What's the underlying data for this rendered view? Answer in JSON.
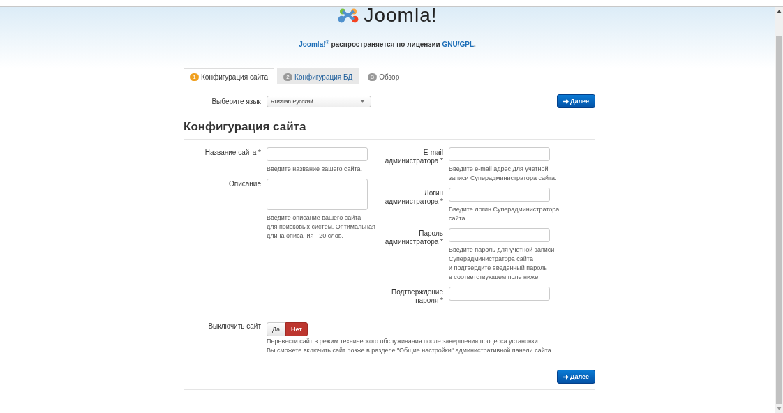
{
  "header": {
    "logo_text": "Joomla!",
    "license": {
      "brand": "Joomla!$^{®}$",
      "text": "распространяется по лицензии",
      "link": "GNU/GPL",
      "end": "."
    }
  },
  "tabs": [
    {
      "number": "1",
      "label": "Конфигурация сайта",
      "selected": true,
      "enabled": true
    },
    {
      "number": "2",
      "label": "Конфигурация БД",
      "selected": false,
      "enabled": true
    },
    {
      "number": "3",
      "label": "Обзор",
      "selected": false,
      "enabled": false
    }
  ],
  "language": {
    "label": "Выберите язык",
    "value": "Russian Русский"
  },
  "next_button_top": {
    "label": "Далее"
  },
  "heading": "Конфигурация сайта",
  "left_fields": [
    {
      "label": [
        "Название сайта *"
      ],
      "kind": "text",
      "hint": [
        "Введите название вашего сайта."
      ]
    },
    {
      "label": [
        "Описание"
      ],
      "kind": "textarea",
      "hint": [
        "Введите описание вашего сайта",
        "для поисковых систем. Оптимальная",
        "длина описания - 20 слов."
      ]
    }
  ],
  "right_fields": [
    {
      "label": [
        "E-mail",
        "администратора *"
      ],
      "kind": "text",
      "hint": [
        "Введите e-mail адрес для учетной",
        "записи Суперадминистратора сайта."
      ]
    },
    {
      "label": [
        "Логин",
        "администратора *"
      ],
      "kind": "text",
      "hint": [
        "Введите логин Суперадминистратора",
        "сайта."
      ]
    },
    {
      "label": [
        "Пароль",
        "администратора *"
      ],
      "kind": "text",
      "hint": [
        "Введите пароль для учетной записи",
        "Суперадминистратора сайта",
        "и подтвердите введенный пароль",
        "в соответствующем поле ниже."
      ]
    },
    {
      "label": [
        "Подтверждение",
        "пароля *"
      ],
      "kind": "text"
    }
  ],
  "offline": {
    "label": "Выключить сайт",
    "options": [
      {
        "label": "Да",
        "selected": false
      },
      {
        "label": "Нет",
        "selected": true
      }
    ],
    "hint": [
      "Перевести сайт в режим технического обслуживания после завершения процесса установки.",
      "Вы сможете включить сайт позже в разделе \"Общие настройки\" административной панели сайта."
    ]
  },
  "next_button_bottom": {
    "label": "Далее"
  }
}
